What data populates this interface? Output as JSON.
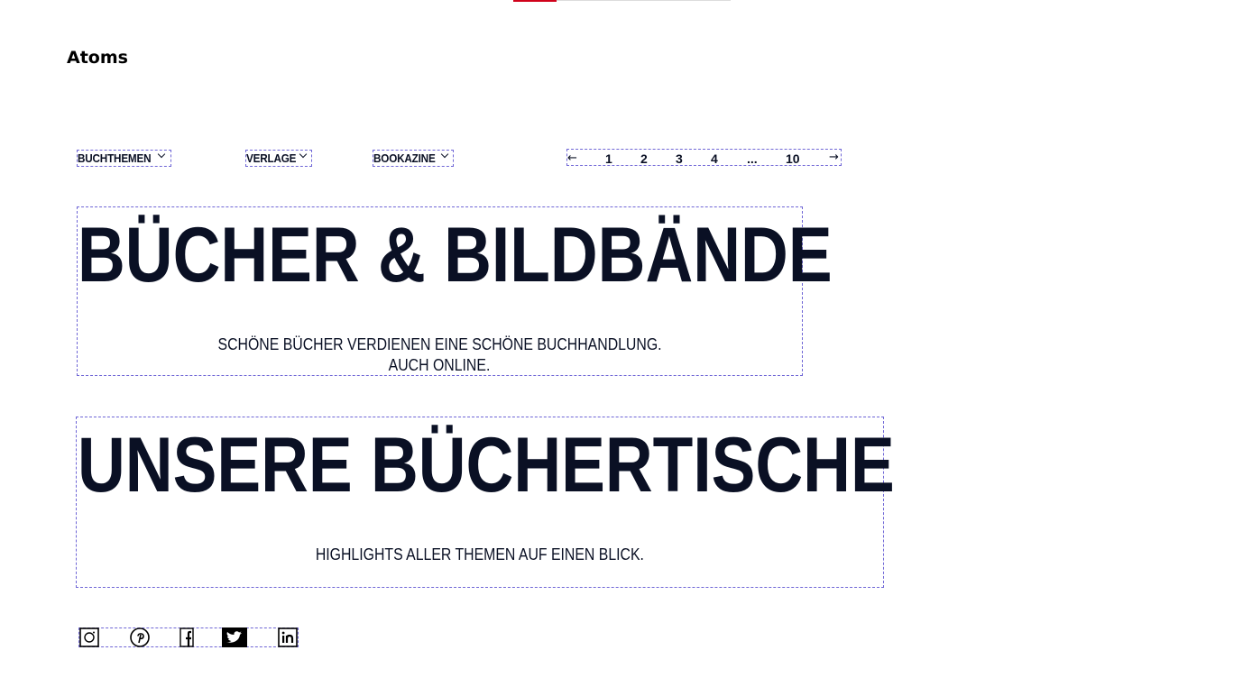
{
  "section_title": "Atoms",
  "dropdowns": [
    {
      "label": "BUCHTHEMEN"
    },
    {
      "label": "VERLAGE"
    },
    {
      "label": "BOOKAZINE"
    }
  ],
  "pagination": {
    "prev": "←",
    "next": "→",
    "pages": [
      "1",
      "2",
      "3",
      "4",
      "...",
      "10"
    ]
  },
  "hero_1": {
    "title": "BÜCHER & BILDBÄNDE",
    "subtitle_line1": "SCHÖNE BÜCHER VERDIENEN EINE SCHÖNE BUCHHANDLUNG.",
    "subtitle_line2": "AUCH ONLINE."
  },
  "hero_2": {
    "title": "UNSERE BÜCHERTISCHE",
    "subtitle_line1": "HIGHLIGHTS ALLER THEMEN AUF EINEN BLICK."
  },
  "social_icons": [
    "instagram-icon",
    "pinterest-icon",
    "facebook-icon",
    "twitter-icon",
    "linkedin-icon"
  ],
  "colors": {
    "text": "#0a1024",
    "guide_border": "#6f66d6",
    "accent": "#d0021b"
  }
}
